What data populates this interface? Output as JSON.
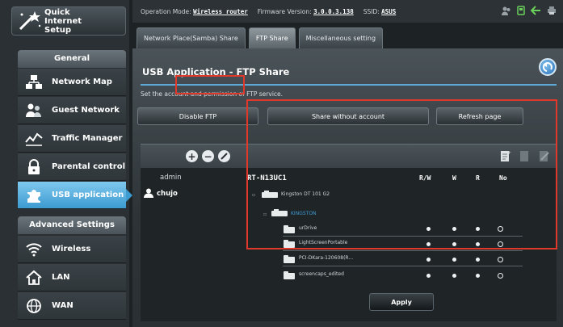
{
  "sidebar": {
    "qis_label": "Quick Internet Setup",
    "general_header": "General",
    "general_items": [
      {
        "label": "Network Map",
        "icon": "network-map-icon"
      },
      {
        "label": "Guest Network",
        "icon": "guest-network-icon"
      },
      {
        "label": "Traffic Manager",
        "icon": "traffic-manager-icon"
      },
      {
        "label": "Parental control",
        "icon": "parental-control-icon"
      },
      {
        "label": "USB application",
        "icon": "usb-application-icon",
        "active": true
      }
    ],
    "advanced_header": "Advanced Settings",
    "advanced_items": [
      {
        "label": "Wireless",
        "icon": "wireless-icon"
      },
      {
        "label": "LAN",
        "icon": "lan-icon"
      },
      {
        "label": "WAN",
        "icon": "wan-icon"
      }
    ]
  },
  "topbar": {
    "mode_label": "Operation Mode:",
    "mode_value": "Wireless router",
    "fw_label": "Firmware Version:",
    "fw_value": "3.0.0.3.138",
    "ssid_label": "SSID:",
    "ssid_value": "ASUS"
  },
  "tabs": [
    {
      "label": "Network Place(Samba) Share",
      "active": false
    },
    {
      "label": "FTP Share",
      "active": true
    },
    {
      "label": "Miscellaneous setting",
      "active": false
    }
  ],
  "main": {
    "title": "USB Application - FTP Share",
    "description": "Set the account and permission of FTP service.",
    "buttons": {
      "disable_ftp": "Disable FTP",
      "share_without_account": "Share without account",
      "refresh_page": "Refresh page"
    },
    "accounts": [
      "admin",
      "chujo"
    ],
    "device": "RT-N13UC1",
    "columns": [
      "R/W",
      "W",
      "R",
      "No"
    ],
    "drive": "Kingston DT 101 G2",
    "partition": "KINGSTON",
    "folders": [
      "urDrive",
      "LightScreenPortable",
      "PCI-DKara-120608(R...",
      "screencaps_edited"
    ],
    "apply_label": "Apply"
  },
  "colors": {
    "accent": "#3c9bd1",
    "annotation": "#e0392c"
  }
}
